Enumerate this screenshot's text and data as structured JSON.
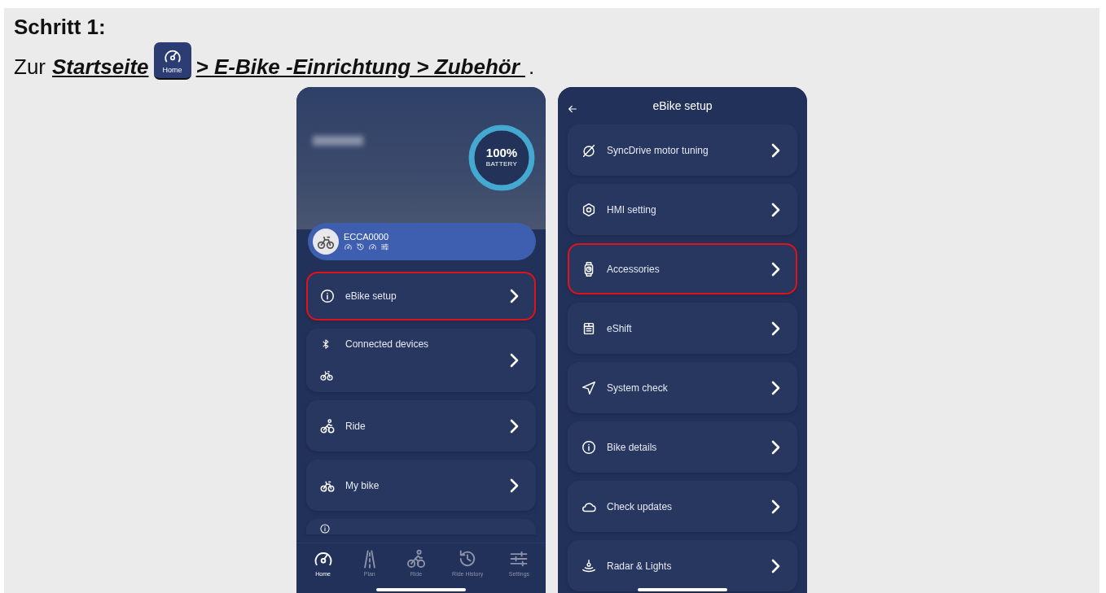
{
  "heading": "Schritt 1:",
  "instruction": {
    "lead": "Zur",
    "link_1": "Startseite",
    "home_icon_label": "Home",
    "link_2": "> E-Bike -Einrichtung > Zubehör",
    "end": "."
  },
  "home_screen": {
    "battery": {
      "level": 1,
      "percent": "100%",
      "label": "BATTERY"
    },
    "bike": {
      "name": "ECCA0000"
    },
    "menu": [
      {
        "kind": "row",
        "label": "eBike setup",
        "highlighted": true
      },
      {
        "kind": "devices",
        "label": "Connected devices",
        "highlighted": false
      },
      {
        "kind": "row",
        "label": "Ride",
        "highlighted": false
      },
      {
        "kind": "row",
        "label": "My bike",
        "highlighted": false
      },
      {
        "kind": "cut_off",
        "highlighted": false
      }
    ],
    "tabs": [
      {
        "label": "Home",
        "selected": true
      },
      {
        "label": "Plan",
        "selected": false
      },
      {
        "label": "Ride",
        "selected": false
      },
      {
        "label": "Ride History",
        "selected": false
      },
      {
        "label": "Settings",
        "selected": false
      }
    ]
  },
  "setup_screen": {
    "title": "eBike setup",
    "items": [
      {
        "label": "SyncDrive motor tuning",
        "highlighted": false
      },
      {
        "label": "HMI setting",
        "highlighted": false
      },
      {
        "label": "Accessories",
        "highlighted": true
      },
      {
        "label": "eShift",
        "highlighted": false
      },
      {
        "label": "System check",
        "highlighted": false
      },
      {
        "label": "Bike details",
        "highlighted": false
      },
      {
        "label": "Check updates",
        "highlighted": false
      },
      {
        "label": "Radar & Lights",
        "highlighted": false
      }
    ]
  }
}
